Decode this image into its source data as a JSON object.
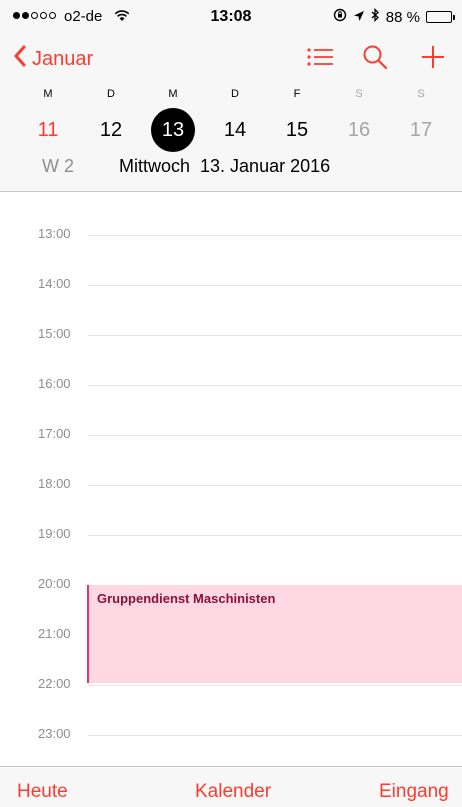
{
  "status_bar": {
    "carrier": "o2-de",
    "time": "13:08",
    "battery": "88 %",
    "battery_level": 0.88,
    "signal_bars_filled": 2,
    "signal_bars_total": 5
  },
  "nav": {
    "back_label": "Januar",
    "accent_color": "#ff3b30"
  },
  "week": {
    "days": [
      "M",
      "D",
      "M",
      "D",
      "F",
      "S",
      "S"
    ],
    "dates": [
      "11",
      "12",
      "13",
      "14",
      "15",
      "16",
      "17"
    ],
    "selected": "13",
    "week_number": "W 2",
    "full_date": "Mittwoch  13. Januar 2016"
  },
  "timeline": {
    "hours": [
      "13:00",
      "14:00",
      "15:00",
      "16:00",
      "17:00",
      "18:00",
      "19:00",
      "20:00",
      "21:00",
      "22:00",
      "23:00"
    ]
  },
  "event": {
    "title": "Gruppendienst Maschinisten",
    "color": "#fdd8e2"
  },
  "tab_bar": {
    "today": "Heute",
    "calendars": "Kalender",
    "inbox": "Eingang"
  }
}
